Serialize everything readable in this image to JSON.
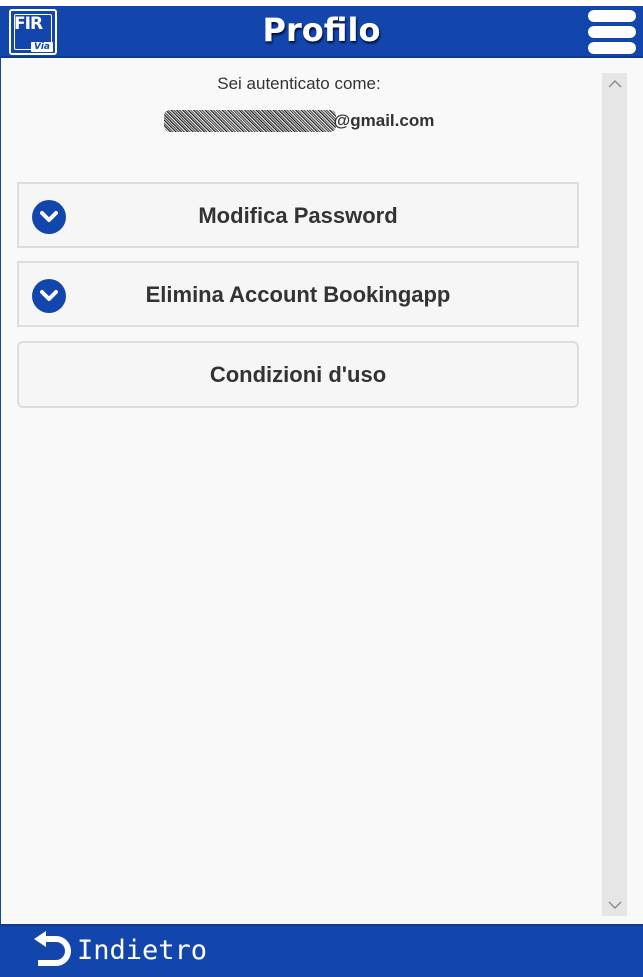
{
  "header": {
    "title": "Profilo",
    "logo_text": "FIR",
    "logo_sub": "Via",
    "menu_icon": "hamburger-menu-icon"
  },
  "auth": {
    "label": "Sei autenticato come:",
    "email_domain": "@gmail.com"
  },
  "actions": [
    {
      "label": "Modifica Password",
      "icon": "chevron-down-icon"
    },
    {
      "label": "Elimina Account Bookingapp",
      "icon": "chevron-down-icon"
    },
    {
      "label": "Condizioni d'uso"
    }
  ],
  "footer": {
    "back_label": "Indietro",
    "back_icon": "undo-arrow-icon"
  },
  "colors": {
    "brand": "#1346ad",
    "background": "#f9f9f9",
    "text": "#333333"
  }
}
